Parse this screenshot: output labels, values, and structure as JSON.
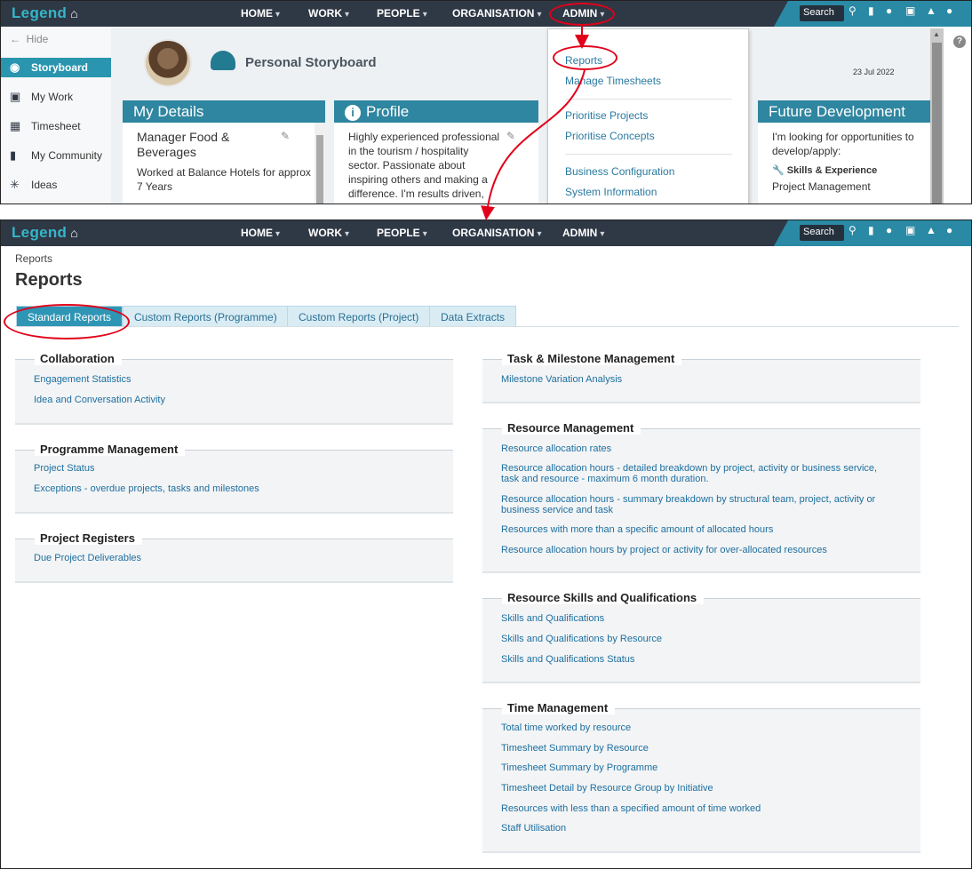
{
  "app": {
    "logo": "Legend"
  },
  "nav": {
    "items": [
      {
        "label": "HOME"
      },
      {
        "label": "WORK"
      },
      {
        "label": "PEOPLE"
      },
      {
        "label": "ORGANISATION"
      },
      {
        "label": "ADMIN"
      }
    ],
    "search_label": "Search"
  },
  "top": {
    "sidebar": {
      "hide_label": "Hide",
      "items": [
        {
          "label": "Storyboard",
          "icon": "palette-icon"
        },
        {
          "label": "My Work",
          "icon": "inbox-icon"
        },
        {
          "label": "Timesheet",
          "icon": "calendar-icon"
        },
        {
          "label": "My Community",
          "icon": "chat-icon"
        },
        {
          "label": "Ideas",
          "icon": "lightbulb-icon"
        }
      ]
    },
    "page_title": "Personal Storyboard",
    "date": "23 Jul 2022",
    "my_details": {
      "title": "My Details",
      "role": "Manager Food & Beverages",
      "text": "Worked at Balance Hotels for approx 7 Years"
    },
    "profile": {
      "title": "Profile",
      "text": "Highly experienced professional in the tourism / hospitality sector. Passionate about inspiring others and making a difference. I'm results driven, love learning and relentlessly"
    },
    "future": {
      "title": "Future Development",
      "text": "I'm looking for opportunities to develop/apply:",
      "skills_label": "Skills & Experience",
      "skills_value": "Project Management"
    },
    "admin_menu": {
      "items": [
        "Reports",
        "Manage Timesheets",
        "Prioritise Projects",
        "Prioritise Concepts",
        "Business Configuration",
        "System Information"
      ]
    }
  },
  "bottom": {
    "breadcrumb": "Reports",
    "title": "Reports",
    "tabs": [
      "Standard Reports",
      "Custom Reports (Programme)",
      "Custom Reports (Project)",
      "Data Extracts"
    ],
    "left_groups": [
      {
        "title": "Collaboration",
        "links": [
          "Engagement Statistics",
          "Idea and Conversation Activity"
        ]
      },
      {
        "title": "Programme Management",
        "links": [
          "Project Status",
          "Exceptions - overdue projects, tasks and milestones"
        ]
      },
      {
        "title": "Project Registers",
        "links": [
          "Due Project Deliverables"
        ]
      }
    ],
    "right_groups": [
      {
        "title": "Task & Milestone Management",
        "links": [
          "Milestone Variation Analysis"
        ]
      },
      {
        "title": "Resource Management",
        "links": [
          "Resource allocation rates",
          "Resource allocation hours - detailed breakdown by project, activity or business service, task and resource - maximum 6 month duration.",
          "Resource allocation hours - summary breakdown by structural team, project, activity or business service and task",
          "Resources with more than a specific amount of allocated hours",
          "Resource allocation hours by project or activity for over-allocated resources"
        ]
      },
      {
        "title": "Resource Skills and Qualifications",
        "links": [
          "Skills and Qualifications",
          "Skills and Qualifications by Resource",
          "Skills and Qualifications Status"
        ]
      },
      {
        "title": "Time Management",
        "links": [
          "Total time worked by resource",
          "Timesheet Summary by Resource",
          "Timesheet Summary by Programme",
          "Timesheet Detail by Resource Group by Initiative",
          "Resources with less than a specified amount of time worked",
          "Staff Utilisation"
        ]
      }
    ]
  },
  "colors": {
    "nav_bg": "#2f3845",
    "accent": "#2f95b5",
    "highlight": "#e2001a",
    "link": "#1d6fa0"
  }
}
